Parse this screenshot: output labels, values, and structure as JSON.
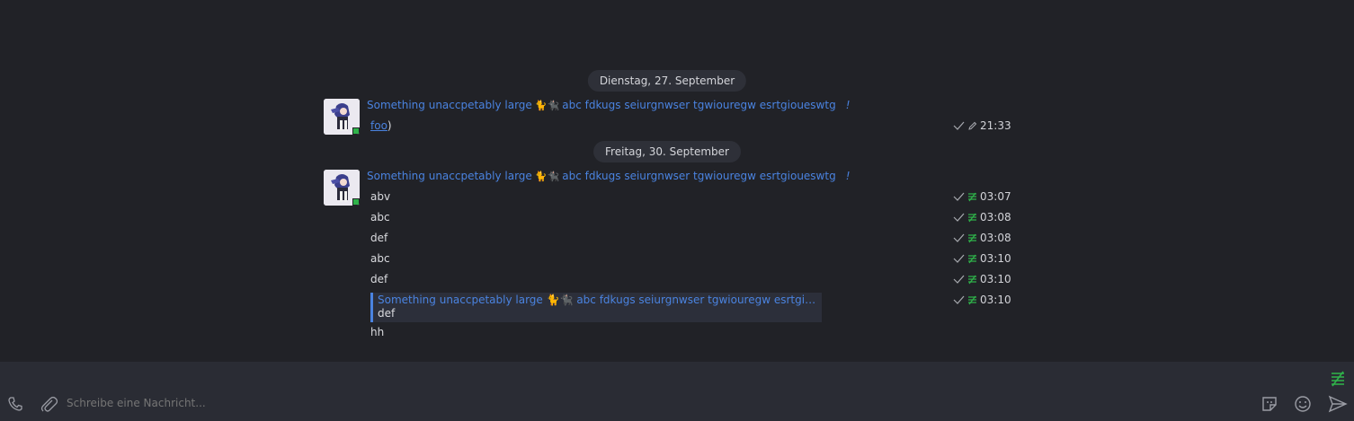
{
  "timeline": {
    "groups": [
      {
        "date": "Dienstag, 27. September",
        "sender": "Something unaccpetably large",
        "sender_suffix": "abc fdkugs seiurgnwser tgwiouregw esrtgioueswtg",
        "warning": "!",
        "messages": [
          {
            "link": "foo",
            "after": ")",
            "time": "21:33",
            "edited": true
          }
        ]
      },
      {
        "date": "Freitag, 30. September",
        "sender": "Something unaccpetably large",
        "sender_suffix": "abc fdkugs seiurgnwser tgwiouregw esrtgioueswtg",
        "warning": "!",
        "messages": [
          {
            "text": "abv",
            "time": "03:07"
          },
          {
            "text": "abc",
            "time": "03:08"
          },
          {
            "text": "def",
            "time": "03:08"
          },
          {
            "text": "abc",
            "time": "03:10"
          },
          {
            "text": "def",
            "time": "03:10"
          },
          {
            "reply_sender": "Something unaccpetably large 🐈🐈‍⬛ abc fdkugs seiurgnwser tgwiouregw esrtgioues...",
            "reply_text": "def",
            "time": "03:10"
          },
          {
            "text": "hh"
          }
        ]
      }
    ]
  },
  "composer": {
    "placeholder": "Schreibe eine Nachricht..."
  },
  "icons": {
    "call": "phone-icon",
    "attach": "paperclip-icon",
    "sticker": "sticker-icon",
    "emoji": "emoji-icon",
    "send": "send-icon",
    "encryption": "encryption-unverified-icon"
  },
  "colors": {
    "accent": "#4a83e0",
    "presence": "#2fb34a",
    "encryption": "#2fb34a"
  }
}
